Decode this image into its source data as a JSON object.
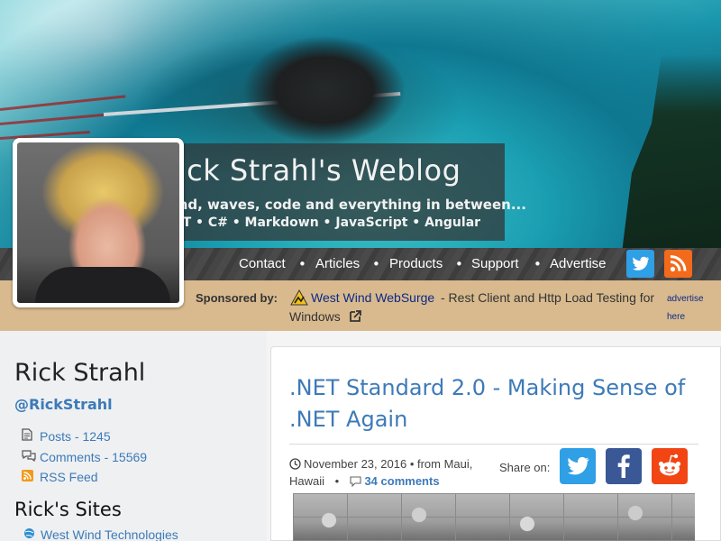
{
  "header": {
    "title": "Rick Strahl's Weblog",
    "tagline": "Wind, waves, code and everything in between...",
    "topics": ".NET • C# • Markdown • JavaScript • Angular"
  },
  "nav": {
    "items": [
      "Contact",
      "Articles",
      "Products",
      "Support",
      "Advertise"
    ],
    "separator": "•",
    "twitter_icon": "twitter-icon",
    "rss_icon": "rss-icon"
  },
  "sponsor": {
    "label": "Sponsored by:",
    "link_text": "West Wind WebSurge",
    "desc_line1": "- Rest Client and Http Load Testing for",
    "desc_line2": "Windows",
    "advertise_line1": "advertise",
    "advertise_line2": "here"
  },
  "sidebar": {
    "author_name": "Rick Strahl",
    "handle": "@RickStrahl",
    "links": [
      {
        "icon": "document-icon",
        "text": "Posts - 1245"
      },
      {
        "icon": "comments-icon",
        "text": "Comments - 15569"
      },
      {
        "icon": "rss-icon",
        "text": "RSS Feed"
      }
    ],
    "sites_title": "Rick's Sites",
    "sites": [
      {
        "icon": "globe-icon",
        "text": "West Wind Technologies"
      }
    ]
  },
  "post": {
    "title": ".NET Standard 2.0 - Making Sense of .NET Again",
    "date": "November 23, 2016",
    "location_prefix": "• from Maui,",
    "location_line2": "Hawaii",
    "bullet": "•",
    "comments": "34 comments",
    "share_label": "Share on:"
  },
  "colors": {
    "accent": "#3d7ab8",
    "twitter": "#2f9fe6",
    "facebook": "#3a5896",
    "reddit": "#f24514",
    "rss": "#f26a1b",
    "sponsor_bar": "#d9ba8e"
  }
}
